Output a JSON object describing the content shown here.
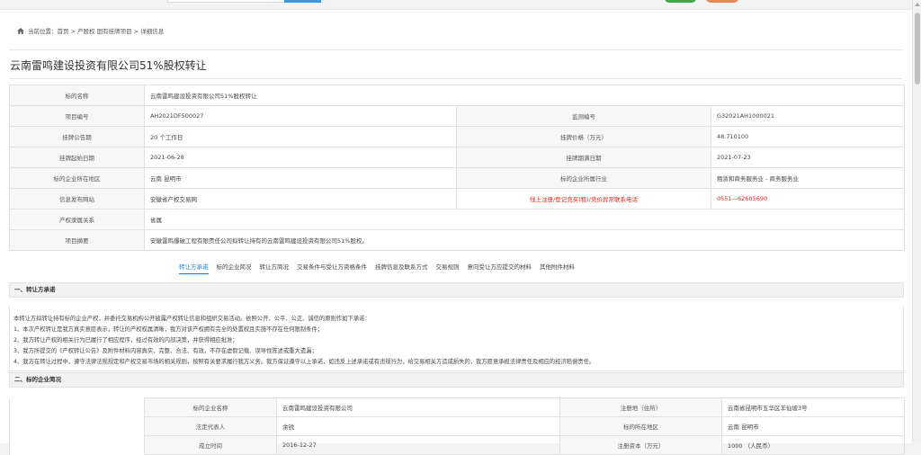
{
  "breadcrumb": {
    "prefix": "当前位置：",
    "home": "首页",
    "sep": ">",
    "level2": "产股权 国有挂牌项目",
    "current": "详细信息"
  },
  "title": "云南雷鸣建设投资有限公司51%股权转让",
  "info": {
    "subject_label": "标的名称",
    "subject_value": "云南雷鸣建设投资有限公司51%股权转让",
    "project_no_label": "项目编号",
    "project_no_value": "AH2021DF500027",
    "monitor_no_label": "监测编号",
    "monitor_no_value": "G32021AH1000021",
    "announce_label": "挂牌公告期",
    "announce_value": "20 个工作日",
    "price_label": "挂牌价格（万元）",
    "price_value": "48.710100",
    "start_label": "挂牌起始日期",
    "start_value": "2021-06-28",
    "end_label": "挂牌期满日期",
    "end_value": "2021-07-23",
    "region_label": "标的企业所在地区",
    "region_value": "云南 昆明市",
    "industry_label": "标的企业所属行业",
    "industry_value": "租赁和商务服务业 - 商务服务业",
    "site_label": "信息发布网站",
    "site_value": "安徽省产权交易网",
    "hotline_label": "线上注册/登记竞买(租)/竞价异常联系电话",
    "hotline_value": "0551—62605690",
    "ownership_label": "产权隶属关系",
    "ownership_value": "省属",
    "summary_label": "项目摘要",
    "summary_value": "安徽雷鸣爆破工程有限责任公司拟转让持有的云南雷鸣建设投资有限公司51%股权。"
  },
  "tabs": [
    "转让方承诺",
    "标的企业简况",
    "转让方简况",
    "交易条件与受让方资格条件",
    "挂牌信息及联系方式",
    "交易规则",
    "意向受让方应提交的材料",
    "其他附件材料"
  ],
  "section1": {
    "heading": "一、转让方承诺",
    "lines": [
      "本转让方拟转让持有标的企业产权，并委托交易机构公开披露产权转让信息和组织交易活动。依照公开、公平、公正、诚信的原则作如下承诺：",
      "1、本次产权转让是我方真实意愿表示，转让的产权权属清晰，我方对该产权拥有完全的处置权且实施不存在任何限制条件；",
      "2、我方转让产权的相关行为已履行了相应程序，经过有效的内部决策，并获得相应批准；",
      "3、我方所提交的《产权转让公告》及附件材料内容真实、完整、合法、有效，不存在虚假记载、误导性陈述或重大遗漏；",
      "4、我方在转让过程中，遵守法律法规规定和产权交易市场的相关规则，按照有关要求履行我方义务。我方保证遵守以上承诺，如违反上述承诺或有违规行为，给交易相关方造成损失的，我方愿意承担法律责任及相应的经济赔偿责任。"
    ]
  },
  "section2": {
    "heading": "二、标的企业简况",
    "rows": [
      {
        "l1": "标的企业名称",
        "v1": "云南雷鸣建设投资有限公司",
        "l2": "注册地（住所）",
        "v2": "云南省昆明市五华区羊仙坡3号"
      },
      {
        "l1": "法定代表人",
        "v1": "余锐",
        "l2": "标的所在地区",
        "v2": "云南 昆明市"
      },
      {
        "l1": "成立时间",
        "v1": "2016-12-27",
        "l2": "注册资本（万元）",
        "v2": "1000 （人民币）"
      }
    ]
  }
}
